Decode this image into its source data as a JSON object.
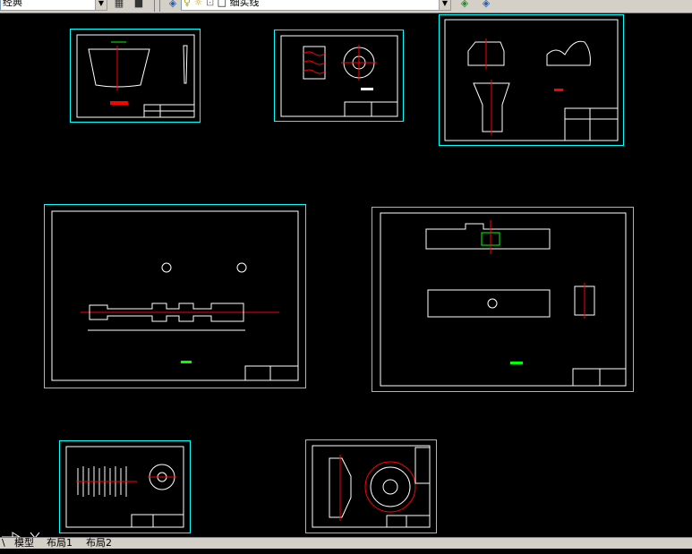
{
  "toolbar": {
    "style_combo": "经典",
    "linetype_combo": "细实线",
    "icons": [
      "dropdown-arrow",
      "layer-icon",
      "layer-state-icon",
      "lightbulb-icon",
      "sun-icon",
      "lock-icon",
      "color-square-icon",
      "layer-previous-icon",
      "layer-manager-icon"
    ]
  },
  "tabs": {
    "model": "模型",
    "layout1": "布局1",
    "layout2": "布局2"
  },
  "ucs": {
    "y_label": "Y",
    "x_label": "X"
  },
  "colors": {
    "frame": "#00ffff",
    "drawing": "#ffffff",
    "accent_red": "#ff0000",
    "accent_green": "#00ff00"
  }
}
